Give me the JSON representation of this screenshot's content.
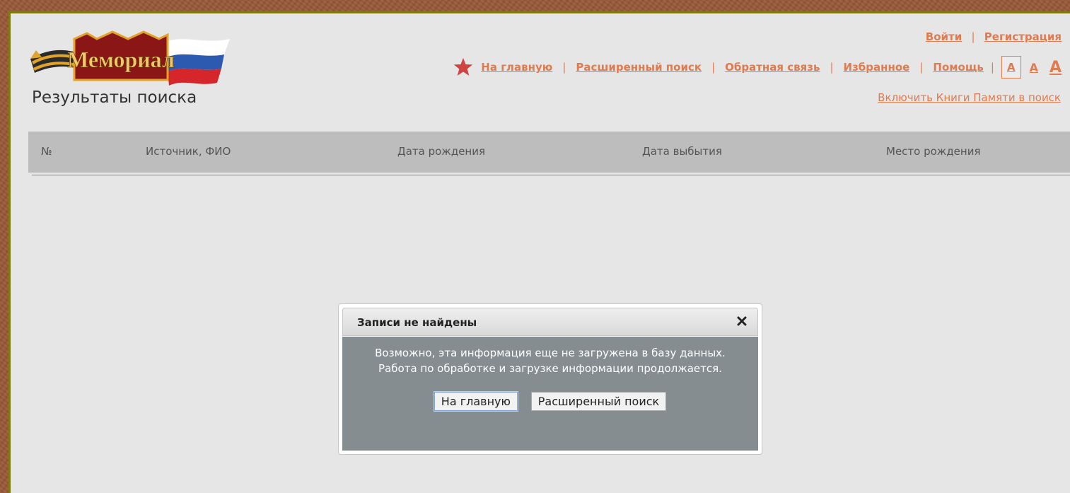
{
  "header": {
    "logo_text": "Мемориал",
    "page_title": "Результаты поиска"
  },
  "auth": {
    "login": "Войти",
    "separator": "|",
    "register": "Регистрация"
  },
  "nav": {
    "items": [
      "На главную",
      "Расширенный поиск",
      "Обратная связь",
      "Избранное",
      "Помощь"
    ],
    "separator": "|",
    "font_sizes": [
      "A",
      "A",
      "A"
    ],
    "star_icon": "star-icon"
  },
  "include_books": "Включить Книги Памяти в поиск",
  "table": {
    "columns": [
      "№",
      "Источник, ФИО",
      "Дата рождения",
      "Дата выбытия",
      "Место рождения"
    ]
  },
  "dialog": {
    "title": "Записи не найдены",
    "message_line1": "Возможно, эта информация еще не загружена в базу данных.",
    "message_line2": "Работа по обработке и загрузке информации продолжается.",
    "buttons": [
      "На главную",
      "Расширенный поиск"
    ]
  },
  "colors": {
    "accent_link": "#e07b50",
    "page_background": "#e6e6e6",
    "table_header": "#bdbdbd",
    "dialog_body": "#868d91",
    "frame": "#9a5a38"
  }
}
